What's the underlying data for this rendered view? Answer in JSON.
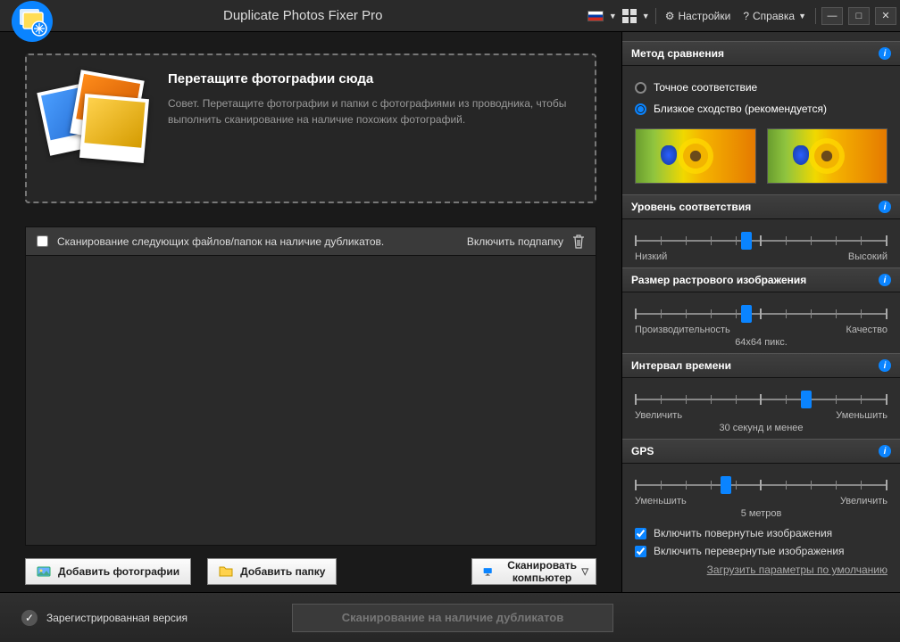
{
  "titlebar": {
    "app_title": "Duplicate Photos Fixer Pro",
    "settings": "Настройки",
    "help": "Справка"
  },
  "dropzone": {
    "heading": "Перетащите фотографии сюда",
    "hint": "Совет. Перетащите фотографии и папки с фотографиями из проводника, чтобы выполнить сканирование на наличие похожих фотографий."
  },
  "scanlist": {
    "heading": "Сканирование следующих файлов/папок на наличие дубликатов.",
    "include_sub": "Включить подпапку"
  },
  "buttons": {
    "add_photos": "Добавить фотографии",
    "add_folder": "Добавить папку",
    "scan_computer": "Сканировать компьютер"
  },
  "sidebar": {
    "compare_method": "Метод сравнения",
    "exact": "Точное соответствие",
    "similar": "Близкое сходство (рекомендуется)",
    "match_level": "Уровень соответствия",
    "match_low": "Низкий",
    "match_high": "Высокий",
    "bitmap_size": "Размер растрового изображения",
    "bitmap_perf": "Производительность",
    "bitmap_val": "64x64 пикс.",
    "bitmap_qual": "Качество",
    "time_interval": "Интервал времени",
    "time_more": "Увеличить",
    "time_val": "30 секунд и менее",
    "time_less": "Уменьшить",
    "gps": "GPS",
    "gps_less": "Уменьшить",
    "gps_val": "5 метров",
    "gps_more": "Увеличить",
    "include_rotated": "Включить повернутые изображения",
    "include_flipped": "Включить перевернутые изображения",
    "load_defaults": "Загрузить параметры по умолчанию"
  },
  "footer": {
    "registered": "Зарегистрированная версия",
    "scan_dup": "Сканирование на наличие дубликатов"
  }
}
